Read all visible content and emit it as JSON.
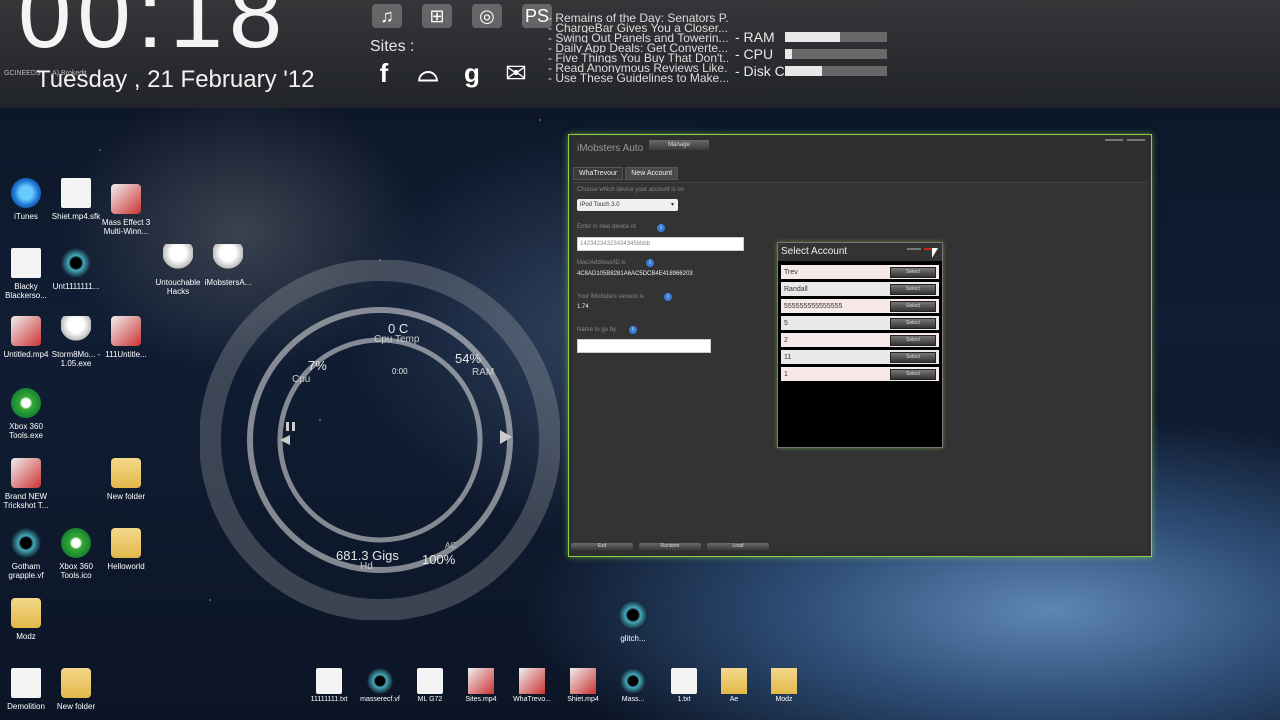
{
  "clock": {
    "time": "00:18",
    "date": "Tuesday , 21 February '12"
  },
  "sites_label": "Sites :",
  "top_icons": [
    "music-icon",
    "windows-icon",
    "globe-icon",
    "ps-icon"
  ],
  "top_icon_ps": "PS",
  "site_icons": [
    {
      "name": "facebook-icon",
      "glyph": "f"
    },
    {
      "name": "cloud-icon",
      "glyph": "⌓"
    },
    {
      "name": "google-icon",
      "glyph": "g"
    },
    {
      "name": "mail-icon",
      "glyph": "✉"
    }
  ],
  "news": [
    "- Remains of the Day: Senators P...",
    "- ChargeBar Gives You a Closer...",
    "- Swing Out Panels and Towerin...",
    "- Daily App Deals: Get Converte...",
    "- Five Things You Buy That Don't...",
    "- Read Anonymous Reviews Like...",
    "- Use These Guidelines to Make..."
  ],
  "meters": [
    {
      "label": "- RAM",
      "value": 0.54
    },
    {
      "label": "- CPU",
      "value": 0.07
    },
    {
      "label": "- Disk C",
      "value": 0.36
    }
  ],
  "widget_labels": {
    "gc": "GCINEEDS",
    "brokedit": "A) Brokedit"
  },
  "gauge": {
    "cpu_temp": "0 C",
    "cpu_temp_label": "Cpu Temp",
    "cpu_pct": "7%",
    "cpu_label": "Cpu",
    "ram_pct": "54%",
    "ram_label": "RAM",
    "media_time": "0:00",
    "hd": "681.3 Gigs",
    "hd_label": "Hd",
    "ac_pct": "100%",
    "ac_label": "AC"
  },
  "desktop_icons": [
    {
      "label": "iTunes",
      "kind": "music"
    },
    {
      "label": "Shiet.mp4.sfk",
      "kind": "file"
    },
    {
      "label": "Mass Effect 3 Multi-Winn...",
      "kind": "game"
    },
    {
      "label": "Blacky Blackerso...",
      "kind": "file"
    },
    {
      "label": "Unt1111111...",
      "kind": "media"
    },
    {
      "label": "Untouchable Hacks",
      "kind": "robot"
    },
    {
      "label": "iMobstersA...",
      "kind": "robot"
    },
    {
      "label": "Untitled.mp4",
      "kind": "game"
    },
    {
      "label": "Storm8Mo... - 1.05.exe",
      "kind": "robot"
    },
    {
      "label": "111Untitle...",
      "kind": "game"
    },
    {
      "label": "Xbox 360 Tools.exe",
      "kind": "xbox"
    },
    {
      "label": "Brand NEW Trickshot T...",
      "kind": "game"
    },
    {
      "label": "New folder",
      "kind": "folder"
    },
    {
      "label": "Gotham grapple.vf",
      "kind": "media"
    },
    {
      "label": "Xbox 360 Tools.ico",
      "kind": "xbox"
    },
    {
      "label": "Helloworld",
      "kind": "folder"
    },
    {
      "label": "Modz",
      "kind": "folder"
    },
    {
      "label": "Demolition",
      "kind": "file"
    },
    {
      "label": "New folder",
      "kind": "folder"
    },
    {
      "label": "glitch...",
      "kind": "media"
    }
  ],
  "taskbar": [
    {
      "label": "11111111.txt",
      "kind": "file"
    },
    {
      "label": "masserecf.vf",
      "kind": "media"
    },
    {
      "label": "ML G72",
      "kind": "file"
    },
    {
      "label": "Sites.mp4",
      "kind": "game"
    },
    {
      "label": "WhaTrevo...",
      "kind": "game"
    },
    {
      "label": "Shiet.mp4",
      "kind": "game"
    },
    {
      "label": "Mass...",
      "kind": "media"
    },
    {
      "label": "1.txt",
      "kind": "file"
    },
    {
      "label": "Ae",
      "kind": "folder"
    },
    {
      "label": "Modz",
      "kind": "folder"
    }
  ],
  "app": {
    "title": "iMobsters Auto",
    "manage": "Manage",
    "tabs": [
      "WhaTrevour",
      "New Account"
    ],
    "device_label": "Choose which device your account is on",
    "device_value": "iPod Touch 3.0",
    "udid_label": "Enter in new device id",
    "udid_value": "14234234323434345bbbb",
    "mac_label": "Mac/Address/ID is",
    "mac_value": "4C8AD105B8281A6AC5DCB4E418966203",
    "version_label": "Your iMobsters version is",
    "version_value": "1.74",
    "name_label": "Name to go by",
    "name_value": "",
    "buttons": [
      "Exit",
      "Random",
      "Load"
    ]
  },
  "dialog": {
    "title": "Select Account",
    "accounts": [
      "Trev",
      "Randall",
      "555555555555555",
      "5",
      "2",
      "11",
      "1"
    ],
    "select_label": "Select"
  }
}
